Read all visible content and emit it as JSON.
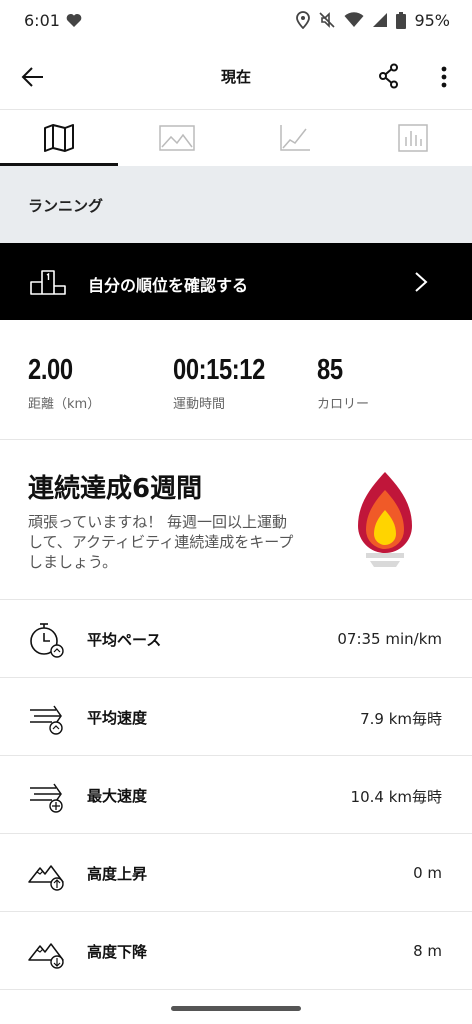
{
  "status_bar": {
    "time": "6:01",
    "battery": "95%",
    "icons": [
      "heart-icon",
      "location-icon",
      "mute-icon",
      "wifi-icon",
      "signal-icon",
      "battery-icon"
    ]
  },
  "header": {
    "title": "現在",
    "icons": [
      "back-arrow-icon",
      "share-icon",
      "more-vert-icon"
    ]
  },
  "tabs": [
    {
      "name": "map",
      "icon": "map-icon",
      "active": true
    },
    {
      "name": "photo",
      "icon": "image-icon",
      "active": false
    },
    {
      "name": "graph",
      "icon": "line-chart-icon",
      "active": false
    },
    {
      "name": "stats",
      "icon": "bar-chart-icon",
      "active": false
    }
  ],
  "activity": {
    "type": "ランニング"
  },
  "rank_banner": {
    "label": "自分の順位を確認する",
    "icon": "podium-icon"
  },
  "stats": {
    "distance": {
      "value": "2.00",
      "label": "距離（km）"
    },
    "duration": {
      "value": "00:15:12",
      "label": "運動時間"
    },
    "calories": {
      "value": "85",
      "label": "カロリー"
    }
  },
  "streak": {
    "title": "連続達成6週間",
    "description": "頑張っていますね！ 毎週一回以上運動して、アクティビティ連続達成をキープしましょう。",
    "icon": "flame-icon",
    "colors": [
      "#c0163a",
      "#f05a28",
      "#ffd400",
      "#d9d9d9"
    ]
  },
  "metrics": [
    {
      "label": "平均ペース",
      "value": "07:35 min/km",
      "icon": "stopwatch-icon"
    },
    {
      "label": "平均速度",
      "value": "7.9 km毎時",
      "icon": "speed-average-icon"
    },
    {
      "label": "最大速度",
      "value": "10.4 km毎時",
      "icon": "speed-max-icon"
    },
    {
      "label": "高度上昇",
      "value": "0 m",
      "icon": "elevation-up-icon"
    },
    {
      "label": "高度下降",
      "value": "8 m",
      "icon": "elevation-down-icon"
    }
  ]
}
